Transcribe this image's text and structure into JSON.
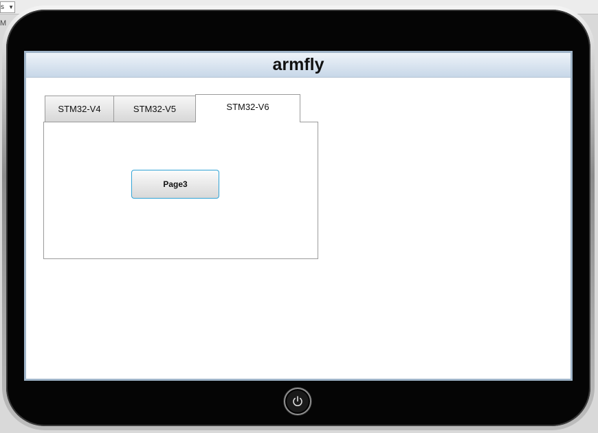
{
  "app": {
    "title": "armfly"
  },
  "host": {
    "combo_value": "s",
    "side_letter": "M"
  },
  "tabs": [
    {
      "label": "STM32-V4",
      "selected": false
    },
    {
      "label": "STM32-V5",
      "selected": false
    },
    {
      "label": "STM32-V6",
      "selected": true
    }
  ],
  "panel": {
    "button_label": "Page3"
  },
  "colors": {
    "bezel": "#050505",
    "titlebar_top": "#eef3f9",
    "titlebar_bottom": "#c7d7e8",
    "button_border": "#2fa3d6"
  },
  "icons": {
    "power": "power-icon"
  }
}
